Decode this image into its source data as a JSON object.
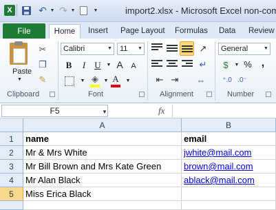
{
  "window": {
    "title": "import2.xlsx - Microsoft Excel non-com",
    "app_icon": "X"
  },
  "tabs": [
    "File",
    "Home",
    "Insert",
    "Page Layout",
    "Formulas",
    "Data",
    "Review"
  ],
  "ribbon": {
    "clipboard": {
      "paste_label": "Paste",
      "group_label": "Clipboard"
    },
    "font": {
      "font_name": "Calibri",
      "font_size": "11",
      "bold": "B",
      "italic": "I",
      "underline": "U",
      "grow": "A",
      "shrink": "A",
      "group_label": "Font"
    },
    "alignment": {
      "group_label": "Alignment"
    },
    "number": {
      "format": "General",
      "percent": "%",
      "comma": ",",
      "group_label": "Number"
    }
  },
  "formula_bar": {
    "name_box": "F5",
    "fx": "fx",
    "content": ""
  },
  "sheet": {
    "columns": [
      "A",
      "B"
    ],
    "rows": [
      {
        "num": "1",
        "a": "name",
        "b": "email"
      },
      {
        "num": "2",
        "a": "Mr & Mrs White",
        "b": "jwhite@mail.com"
      },
      {
        "num": "3",
        "a": "Mr Bill Brown and Mrs Kate Green",
        "b": "brown@mail.com"
      },
      {
        "num": "4",
        "a": "Mr Alan Black",
        "b": "ablack@mail.com"
      },
      {
        "num": "5",
        "a": "Miss Erica Black",
        "b": ""
      }
    ]
  },
  "colors": {
    "file_tab": "#1f7a33",
    "selected_row_header": "#f8d88c",
    "link": "#0000e0"
  }
}
